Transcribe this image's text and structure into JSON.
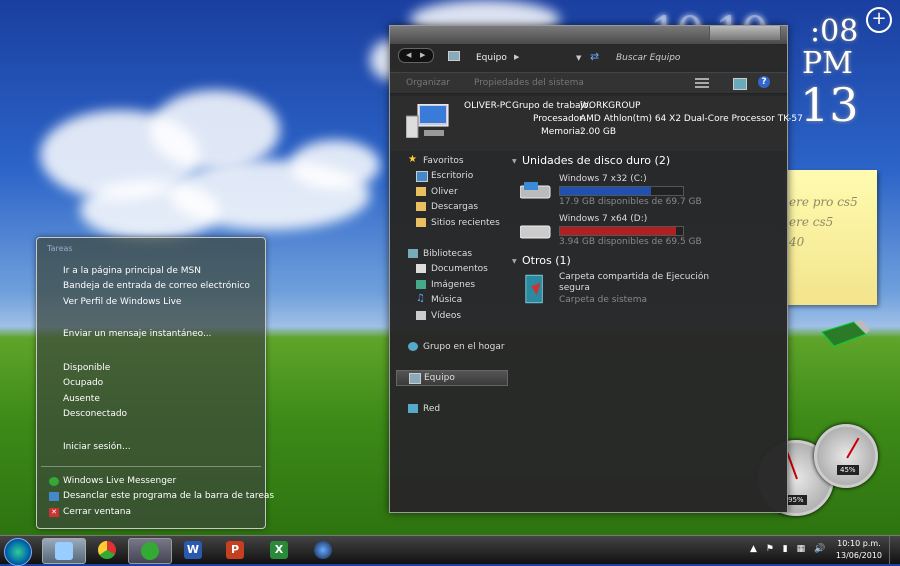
{
  "desktop_clock": {
    "hm": "10:10",
    "sec": ":08",
    "ampm": "PM",
    "day": "13"
  },
  "gadget_add": "+",
  "sticky_note": {
    "lines": [
      "ere pro cs5",
      "ere cs5",
      "40"
    ]
  },
  "gauges": {
    "left_pct": "95%",
    "right_pct": "45%"
  },
  "explorer": {
    "address": {
      "crumb": "Equipo",
      "search": "Buscar Equipo"
    },
    "toolbar": {
      "organize": "Organizar",
      "props": "Propiedades del sistema"
    },
    "computer": {
      "name": "OLIVER-PC",
      "workgroup_label": "Grupo de trabajo:",
      "workgroup": "WORKGROUP",
      "processor_label": "Procesador:",
      "processor": "AMD Athlon(tm) 64 X2 Dual-Core Processor TK-57",
      "memory_label": "Memoria:",
      "memory": "2.00 GB"
    },
    "nav": {
      "favoritos": "Favoritos",
      "escritorio": "Escritorio",
      "oliver": "Oliver",
      "descargas": "Descargas",
      "sitios": "Sitios recientes",
      "bibliotecas": "Bibliotecas",
      "documentos": "Documentos",
      "imagenes": "Imágenes",
      "musica": "Música",
      "videos": "Vídeos",
      "grupo": "Grupo en el hogar",
      "equipo": "Equipo",
      "red": "Red"
    },
    "hdd_group": "Unidades de disco duro (2)",
    "drives": [
      {
        "name": "Windows 7 x32 (C:)",
        "space": "17.9 GB disponibles de 69.7 GB",
        "fill": 0.74,
        "color": "#2050b0"
      },
      {
        "name": "Windows 7 x64 (D:)",
        "space": "3.94 GB disponibles de 69.5 GB",
        "fill": 0.94,
        "color": "#b02020"
      }
    ],
    "other_group": "Otros (1)",
    "other": {
      "name_line1": "Carpeta compartida de Ejecución",
      "name_line2": "segura",
      "type": "Carpeta de sistema"
    }
  },
  "jumplist": {
    "header": "Tareas",
    "tasks": [
      "Ir a la página principal de MSN",
      "Bandeja de entrada de correo electrónico",
      "Ver Perfil de Windows Live"
    ],
    "send": "Enviar un mensaje instantáneo...",
    "status": [
      "Disponible",
      "Ocupado",
      "Ausente",
      "Desconectado"
    ],
    "signin": "Iniciar sesión...",
    "app": "Windows Live Messenger",
    "unpin": "Desanclar este programa de la barra de tareas",
    "close": "Cerrar ventana"
  },
  "taskbar": {
    "word": "W",
    "ppt": "P",
    "excel": "X",
    "time": "10:10 p.m.",
    "date": "13/06/2010"
  }
}
